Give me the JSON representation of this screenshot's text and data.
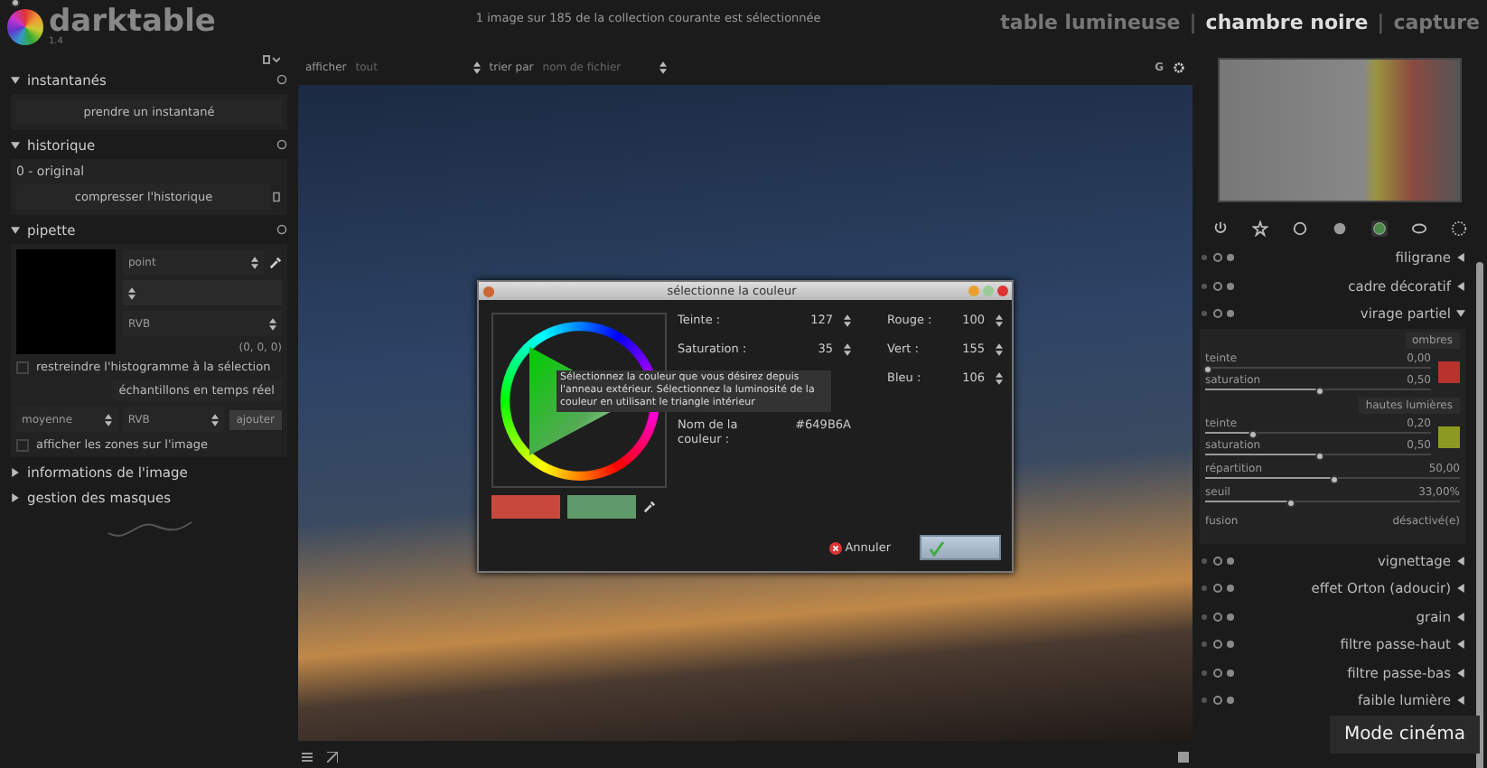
{
  "header": {
    "logo": "darktable",
    "version": "1.4",
    "status": "1 image sur 185 de la collection courante est sélectionnée",
    "separator": "|",
    "views": [
      {
        "label": "table lumineuse",
        "selected": false
      },
      {
        "label": "chambre noire",
        "selected": true
      },
      {
        "label": "capture",
        "selected": false
      }
    ]
  },
  "toolbar": {
    "show_label": "afficher",
    "show_value": "tout",
    "sort_label": "trier par",
    "sort_value": "nom de fichier",
    "grouping": "G"
  },
  "left_panel": {
    "sections": [
      {
        "kind": "snapshots",
        "title": "instantanés",
        "expanded": true,
        "button": "prendre un instantané"
      },
      {
        "kind": "history",
        "title": "historique",
        "expanded": true,
        "item": "0 - original",
        "button": "compresser l'historique"
      },
      {
        "kind": "picker",
        "title": "pipette",
        "expanded": true,
        "mode": "point",
        "model": "RVB",
        "reading": "(0, 0, 0)",
        "restrict": {
          "label": "restreindre l'histogramme à la sélection",
          "checked": false
        },
        "live_button": "échantillons en temps réel",
        "stat": "moyenne",
        "stat_model": "RVB",
        "add_button": "ajouter",
        "show_areas": {
          "label": "afficher les zones sur l'image",
          "checked": false
        }
      },
      {
        "kind": "collapsed",
        "title": "informations de l'image",
        "expanded": false
      },
      {
        "kind": "collapsed",
        "title": "gestion des masques",
        "expanded": false
      }
    ]
  },
  "right_panel": {
    "module_groups": [
      {
        "selected": false
      },
      {
        "selected": false
      },
      {
        "selected": false
      },
      {
        "selected": false
      },
      {
        "selected": true
      },
      {
        "selected": false
      },
      {
        "selected": false
      }
    ],
    "modules": [
      {
        "name": "filigrane",
        "expanded": false
      },
      {
        "name": "cadre décoratif",
        "expanded": false
      },
      {
        "name": "virage partiel",
        "expanded": true
      },
      {
        "name": "vignettage",
        "expanded": false
      },
      {
        "name": "effet Orton (adoucir)",
        "expanded": false
      },
      {
        "name": "grain",
        "expanded": false
      },
      {
        "name": "filtre passe-haut",
        "expanded": false
      },
      {
        "name": "filtre passe-bas",
        "expanded": false
      },
      {
        "name": "faible lumière",
        "expanded": false
      }
    ],
    "split_toning": {
      "groups": [
        {
          "title": "ombres",
          "color": "#b8332c",
          "sliders": [
            {
              "label": "teinte",
              "value": "0,00",
              "level": 0.0
            },
            {
              "label": "saturation",
              "value": "0,50",
              "level": 0.5
            }
          ]
        },
        {
          "title": "hautes lumières",
          "color": "#8c9a22",
          "sliders": [
            {
              "label": "teinte",
              "value": "0,20",
              "level": 0.2
            },
            {
              "label": "saturation",
              "value": "0,50",
              "level": 0.5
            }
          ]
        }
      ],
      "extra_sliders": [
        {
          "label": "répartition",
          "value": "50,00",
          "level": 0.5
        },
        {
          "label": "seuil",
          "value": "33,00%",
          "level": 0.33
        }
      ],
      "blend_label": "fusion",
      "blend_value": "désactivé(e)"
    }
  },
  "dialog": {
    "title": "sélectionne la couleur",
    "left_fields": [
      {
        "label": "Teinte :",
        "value": "127"
      },
      {
        "label": "Saturation :",
        "value": "35"
      }
    ],
    "right_fields": [
      {
        "label": "Rouge :",
        "value": "100"
      },
      {
        "label": "Vert :",
        "value": "155"
      },
      {
        "label": "Bleu :",
        "value": "106"
      }
    ],
    "name_label": "Nom de la couleur :",
    "name_value": "#649B6A",
    "previews": [
      {
        "color": "#c9483e"
      },
      {
        "color": "#5f9a6a"
      }
    ],
    "cancel": "Annuler",
    "tooltip": "Sélectionnez la couleur que vous désirez depuis l'anneau extérieur. Sélectionnez la luminosité de la couleur en utilisant le triangle intérieur"
  },
  "toast": "Mode cinéma"
}
